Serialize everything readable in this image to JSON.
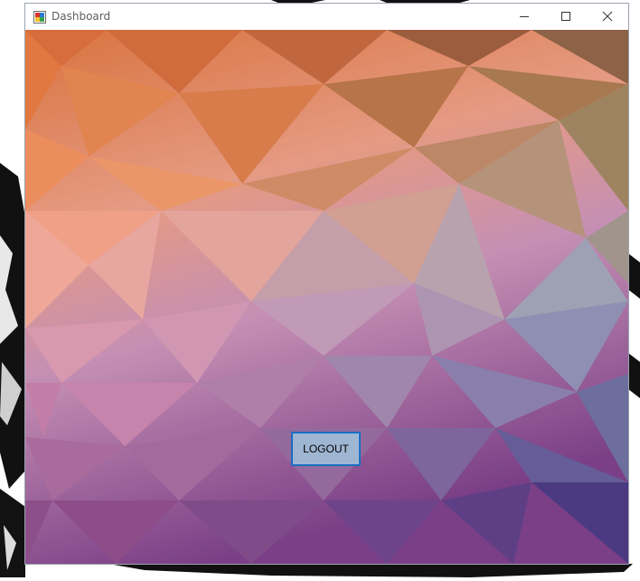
{
  "window": {
    "title": "Dashboard",
    "icon": "app-window-icon"
  },
  "controls": {
    "minimize_icon": "minimize-icon",
    "maximize_icon": "maximize-icon",
    "close_icon": "close-icon"
  },
  "main": {
    "logout_label": "LOGOUT",
    "background": "low-poly gradient artwork"
  },
  "colors": {
    "button_border": "#1a6fc4",
    "button_fill": "#9fb6d3",
    "title_text": "#5e5e5e"
  }
}
